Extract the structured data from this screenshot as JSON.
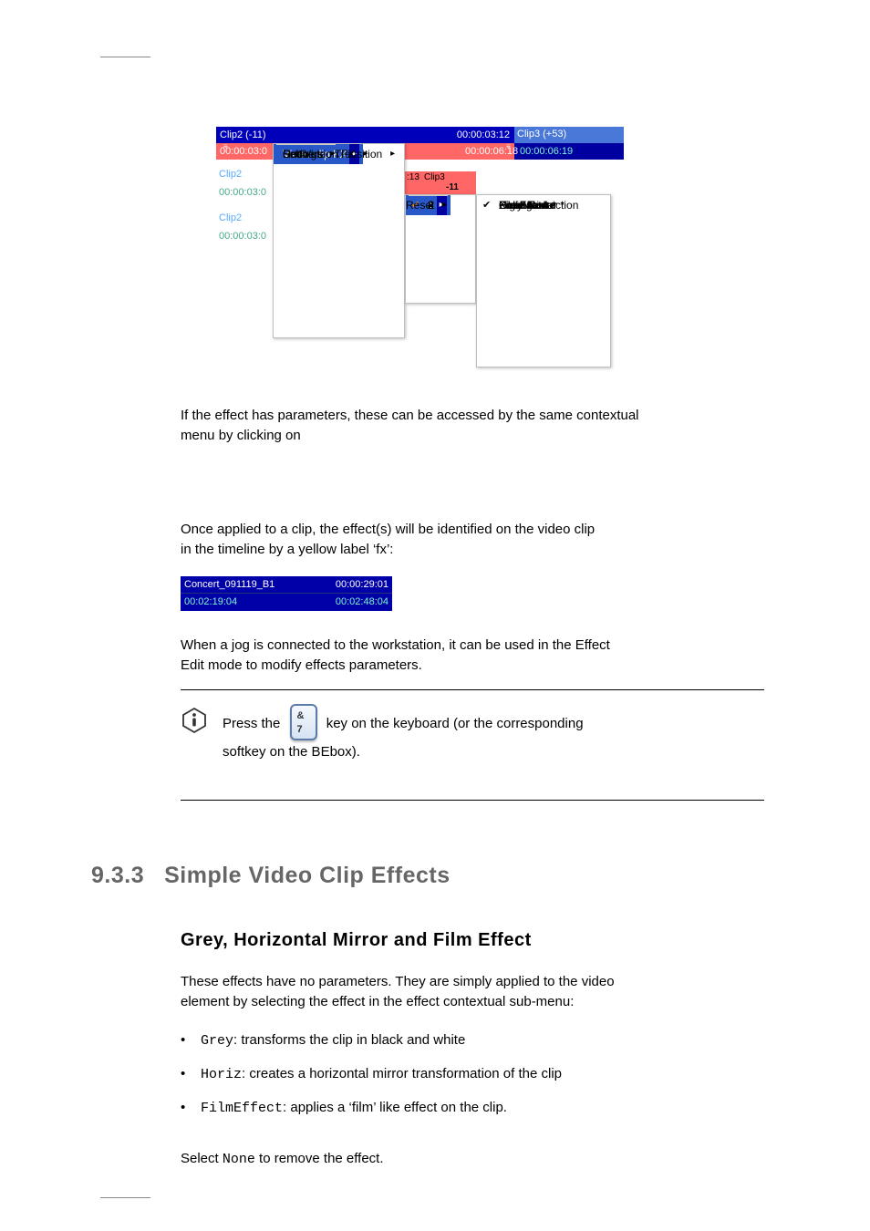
{
  "sshot1": {
    "header": {
      "clip2_label": "Clip2 (-11)",
      "clip2_tc": "00:00:03:12",
      "clip3_label": "Clip3 (+53)",
      "clip2_tc_red": "00:00:03:0",
      "clip3_tc_a": "00:00:06:18",
      "clip3_tc_b": "00:00:06:19"
    },
    "tracks": [
      {
        "label": "Clip2",
        "tc": "00:00:03:0"
      },
      {
        "label": "Clip2",
        "tc": "00:00:03:0"
      }
    ],
    "track_overlay": {
      "tc": ":13",
      "name": "Clip3",
      "offset": "-11"
    },
    "menu1": [
      {
        "label": "Clip",
        "arrow": true
      },
      {
        "label": "Speed",
        "arrow": true
      },
      {
        "label": "Video clip FX",
        "arrow": true,
        "highlight": true
      },
      {
        "label": "Conversion FX",
        "arrow": true
      },
      {
        "label": "Left Video Transition",
        "arrow": true
      },
      {
        "label": "Undo",
        "sep": true
      },
      {
        "label": "Redo"
      },
      {
        "label": "Settings",
        "arrow": true,
        "sep": true
      }
    ],
    "menu2": [
      {
        "label": "1",
        "arrow": true,
        "check": true,
        "highlight": true
      },
      {
        "label": "2",
        "arrow": true
      },
      {
        "label": "3",
        "arrow": true
      },
      {
        "label": "4",
        "arrow": true
      },
      {
        "label": "Reset",
        "sep": true
      }
    ],
    "menu3": [
      {
        "label": "None"
      },
      {
        "label": "Grey",
        "check": true
      },
      {
        "label": "Horiz mirror"
      },
      {
        "label": "FilmEffect"
      },
      {
        "label": "Color Fade"
      },
      {
        "label": "Color Correction"
      },
      {
        "label": "Highlight *"
      },
      {
        "label": "PixelMask *"
      },
      {
        "label": "ZoomLinear *"
      }
    ]
  },
  "body1_lines": [
    "Once applied to a clip, the effect(s) will be identified on the video clip",
    "in the timeline by a yellow label ‘fx’:"
  ],
  "body2_lines": [
    "If the effect has parameters, these can be accessed by the same contextual",
    "menu by clicking on "
  ],
  "sshot2": {
    "name": "Concert_091119_B1",
    "dur": "00:00:29:01",
    "tc_a": "00:02:19:04",
    "tc_b": "00:02:48:04"
  },
  "body3_lines": [
    "When a jog is connected to the workstation, it can be used in the Effect",
    "Edit mode to modify effects parameters."
  ],
  "note": {
    "line1_a": "Press the ",
    "line1_b": " key on the keyboard (or the corresponding",
    "line2": "softkey on the BEbox)."
  },
  "key": {
    "and": "&",
    "seven": "7"
  },
  "section": {
    "number": "9.3.3",
    "title": "Simple Video Clip Effects"
  },
  "subsection": {
    "title": "Grey, Horizontal Mirror and Film Effect"
  },
  "body4_lines": [
    "These effects have no parameters. They are simply applied to the video",
    "element by selecting the effect in the effect contextual sub-menu:"
  ],
  "fx_list": [
    {
      "name": "Grey",
      "desc": ": transforms the clip in black and white"
    },
    {
      "name": "Horiz",
      "desc": ": creates a horizontal mirror transformation of the clip"
    },
    {
      "name": "FilmEffect",
      "desc": ": applies a ‘film’ like effect on the clip."
    }
  ],
  "body5": "Select                to remove the effect.",
  "none_mono": "None"
}
